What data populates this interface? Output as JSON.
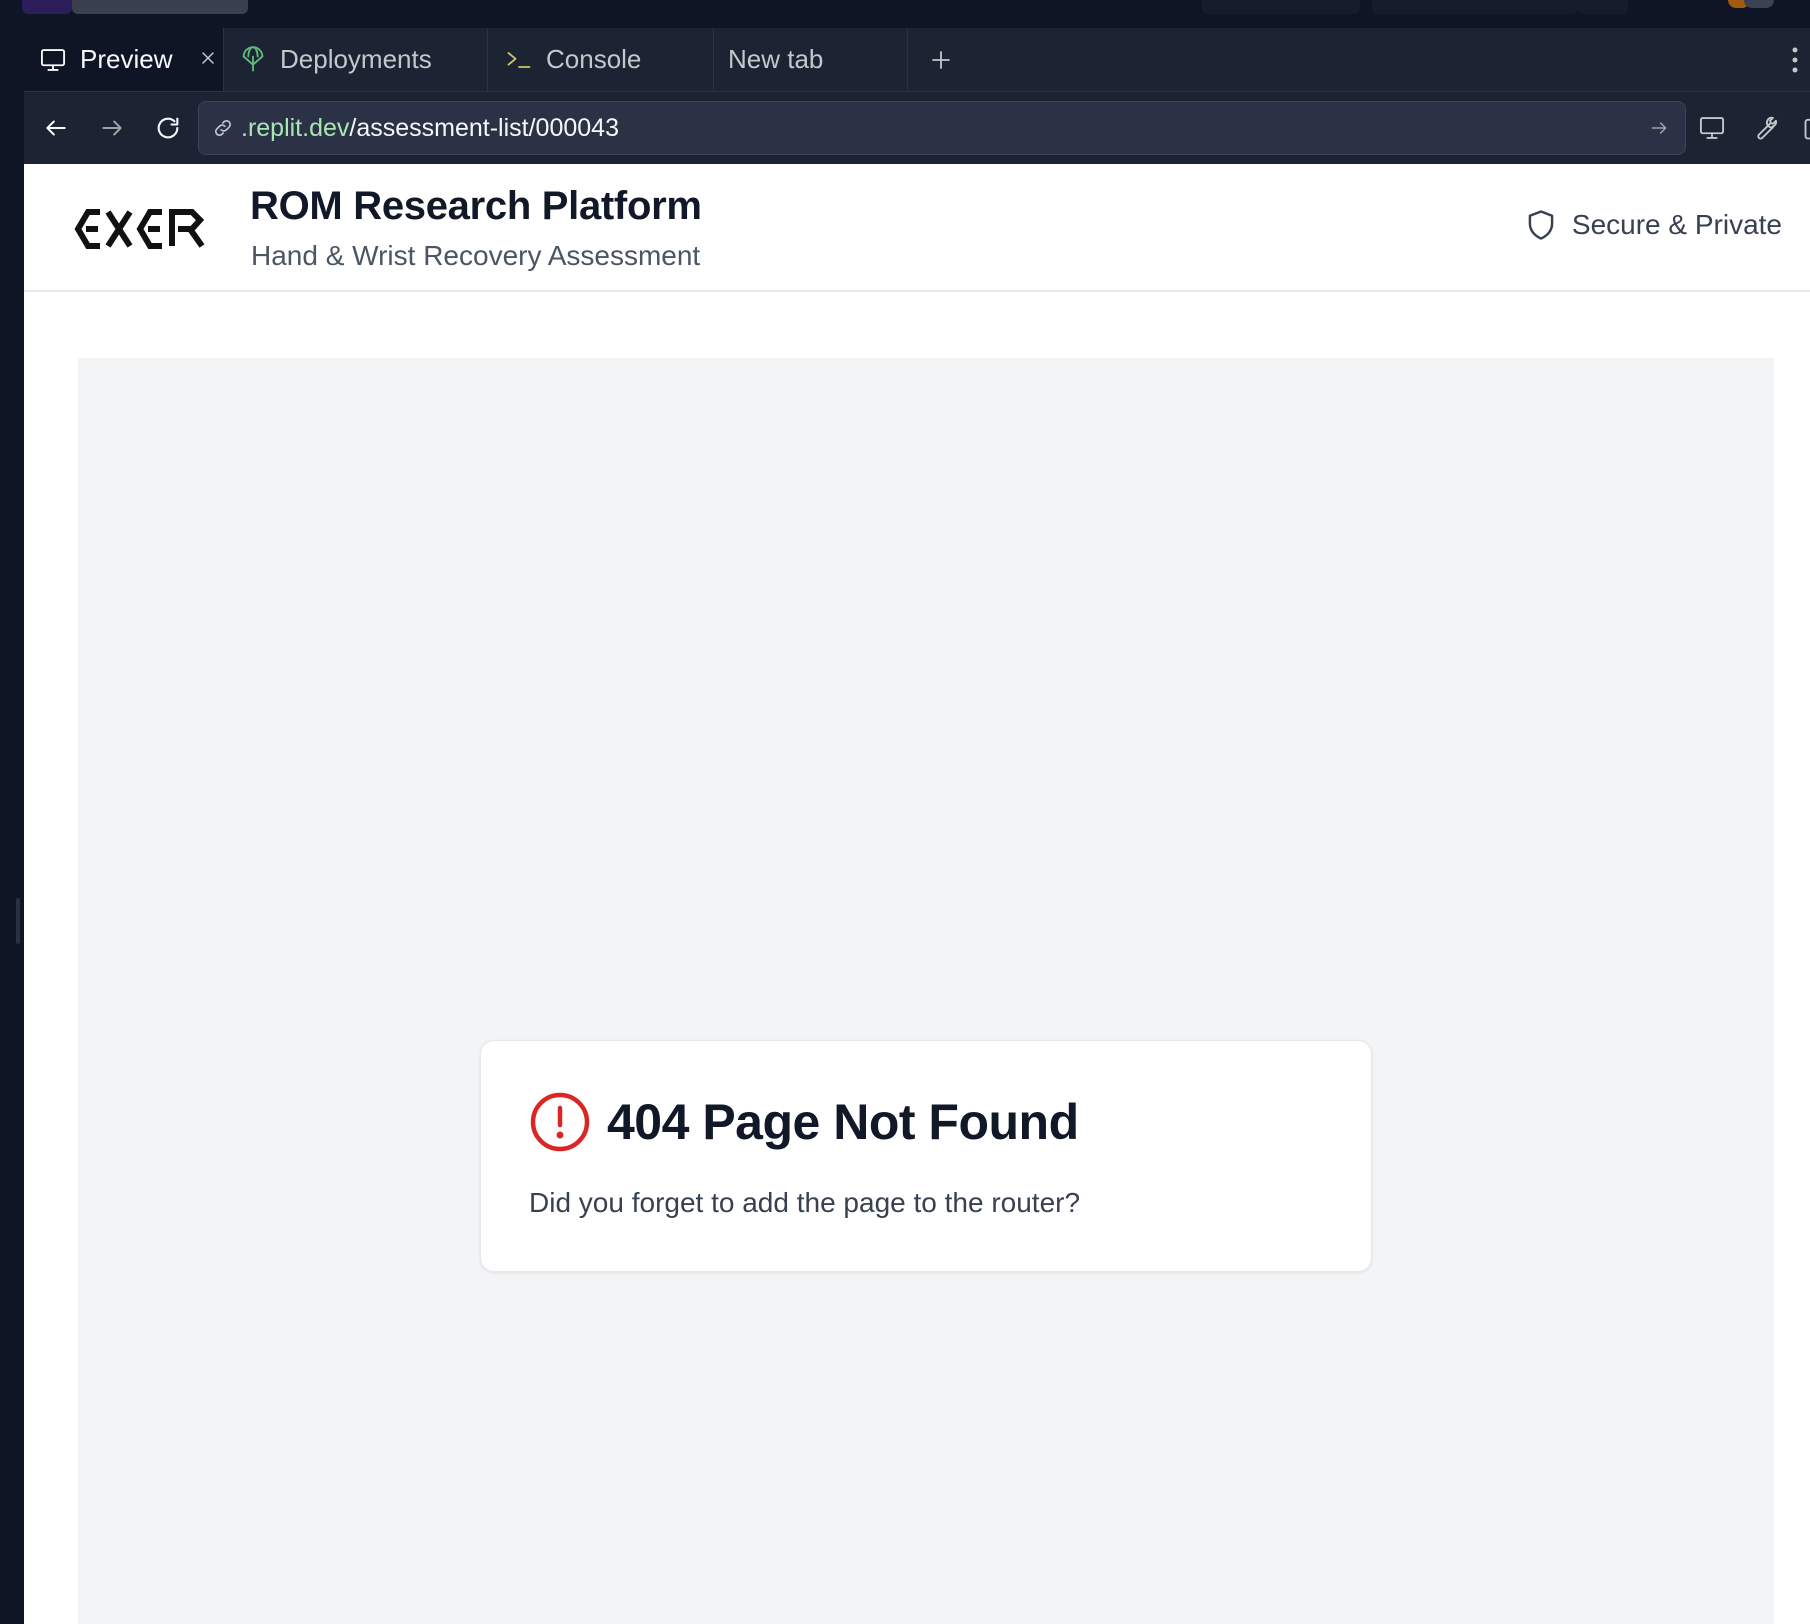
{
  "tabs": [
    {
      "label": "Preview",
      "icon": "monitor-icon",
      "active": true
    },
    {
      "label": "Deployments",
      "icon": "deployments-icon",
      "active": false
    },
    {
      "label": "Console",
      "icon": "terminal-icon",
      "active": false
    },
    {
      "label": "New tab",
      "icon": "",
      "active": false
    }
  ],
  "url": {
    "domain": ".replit.dev",
    "path": "/assessment-list/000043"
  },
  "app": {
    "title": "ROM Research Platform",
    "subtitle": "Hand & Wrist Recovery Assessment",
    "badge": "Secure & Private"
  },
  "error": {
    "title": "404 Page Not Found",
    "message": "Did you forget to add the page to the router?"
  },
  "colors": {
    "accent_error": "#dc2626",
    "url_domain": "#a8e6b4",
    "chrome_bg": "#1c2333"
  }
}
